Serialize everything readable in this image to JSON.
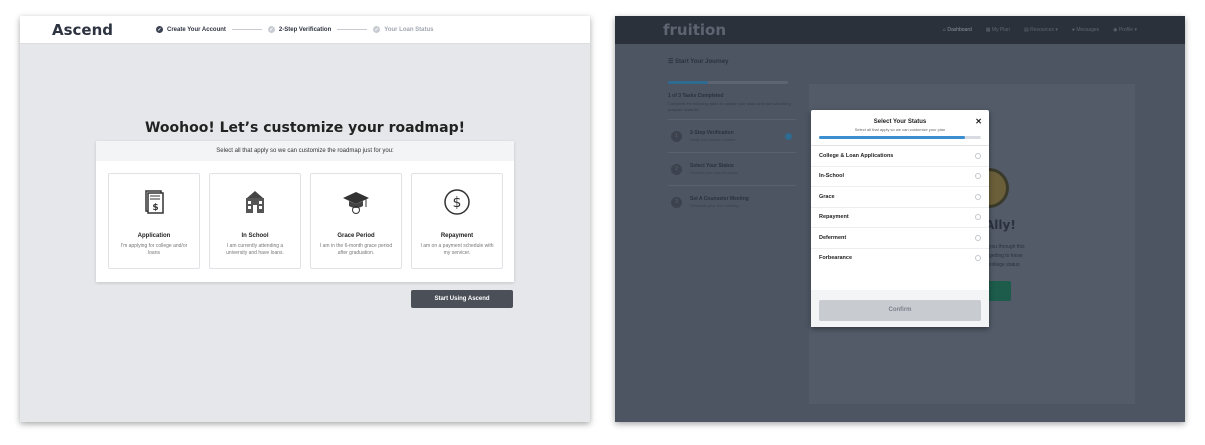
{
  "ascend": {
    "logo": "Ascend",
    "steps": [
      {
        "label": "Create Your Account"
      },
      {
        "label": "2-Step Verification"
      },
      {
        "label": "Your Loan Status"
      }
    ],
    "title": "Woohoo! Let’s customize your roadmap!",
    "instruction": "Select all that apply so we can customize the roadmap just for you:",
    "tiles": [
      {
        "title": "Application",
        "desc": "I'm applying for college and/or loans"
      },
      {
        "title": "In School",
        "desc": "I am currently attending a university and have loans."
      },
      {
        "title": "Grace Period",
        "desc": "I am in the 6-month grace period after graduation."
      },
      {
        "title": "Repayment",
        "desc": "I am on a payment schedule with my servicer."
      }
    ],
    "start_button": "Start Using Ascend"
  },
  "fruition": {
    "logo": "fruition",
    "nav": [
      "Dashboard",
      "My Plan",
      "Resources",
      "Messages",
      "Profile"
    ],
    "sidebar": {
      "header": "Start Your Journey",
      "progress": 0.33,
      "count": "1 of 3 Tasks Completed",
      "sub": "Complete the following tasks to update your tasks and start unlocking purpose rewards!",
      "tasks": [
        {
          "num": "1",
          "title": "2-Step Verification",
          "sub": "Verify your phone number"
        },
        {
          "num": "2",
          "title": "Select Your Status",
          "sub": "Choose your current status"
        },
        {
          "num": "3",
          "title": "Set A Counselor Meeting",
          "sub": "Schedule your first meeting"
        }
      ]
    },
    "behind": {
      "ally": "Ally!",
      "line1": "you through this",
      "line2": "getting to know",
      "line3": "college status"
    },
    "modal": {
      "title": "Select Your Status",
      "subtitle": "Select all that apply so we can customize your plan",
      "close": "✕",
      "progress": 0.9,
      "options": [
        "College & Loan Applications",
        "In-School",
        "Grace",
        "Repayment",
        "Deferment",
        "Forbearance"
      ],
      "confirm": "Confirm"
    }
  }
}
